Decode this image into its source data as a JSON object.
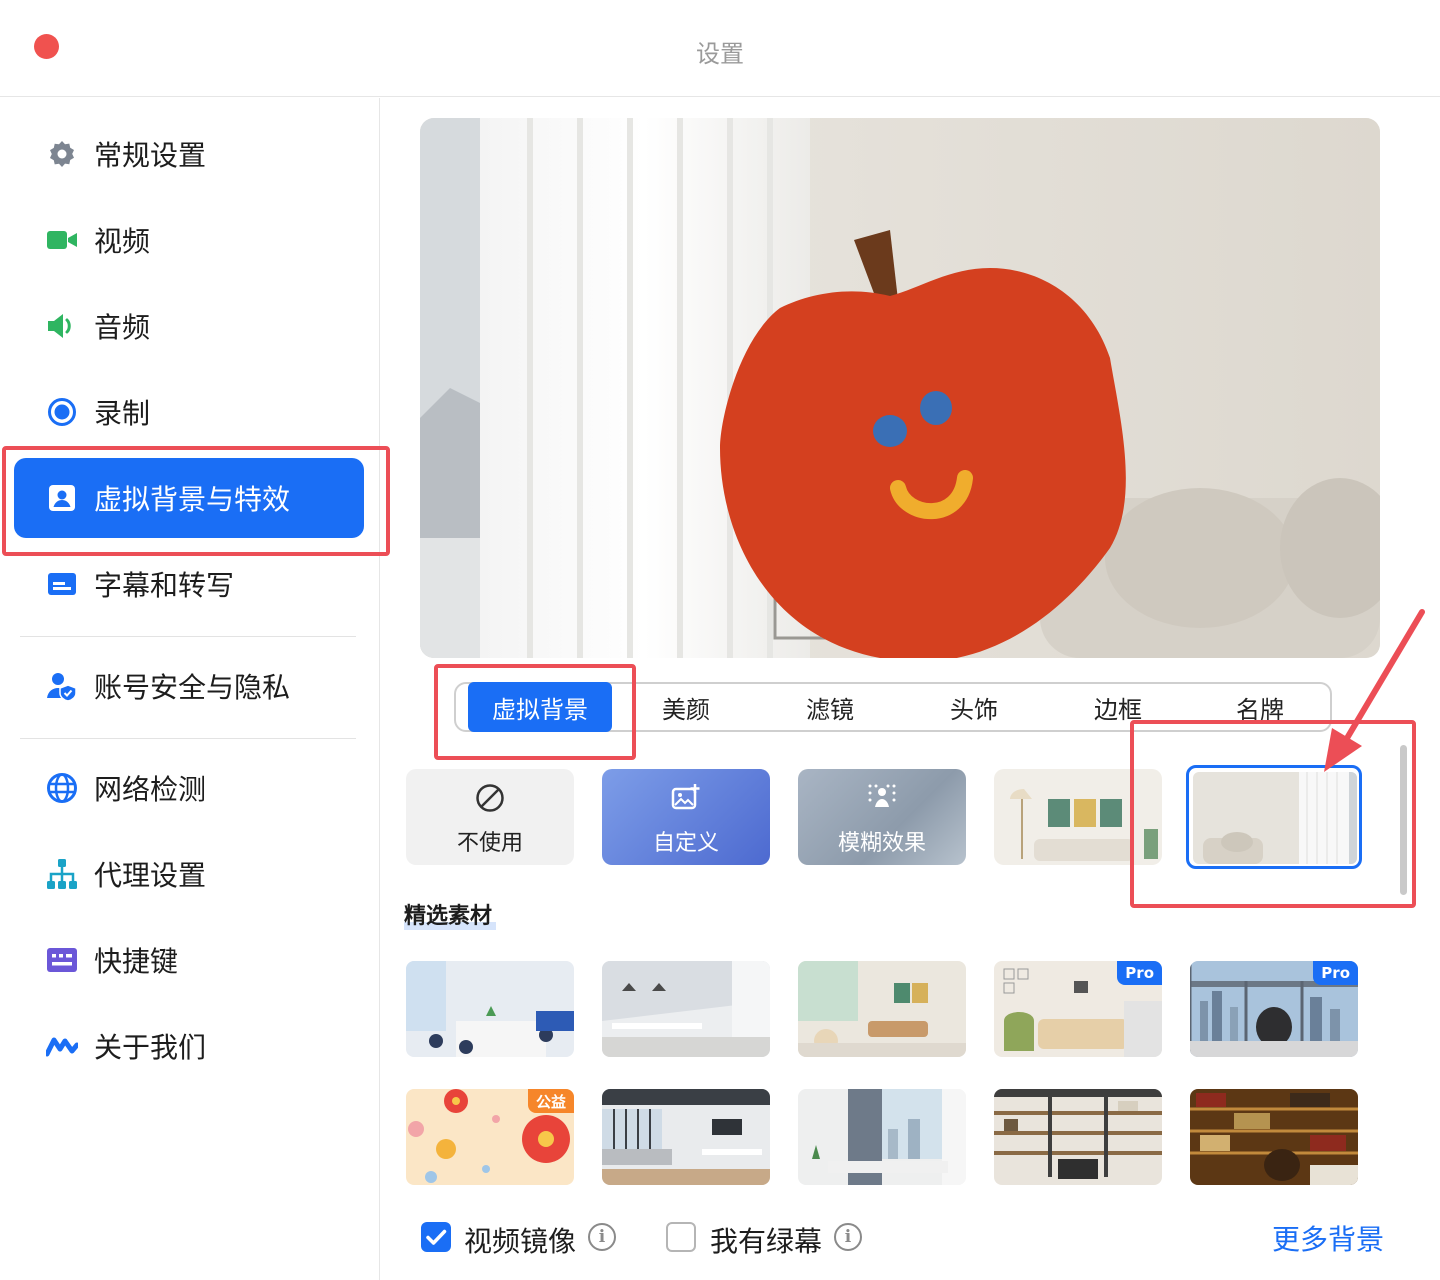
{
  "window": {
    "title": "设置"
  },
  "sidebar": {
    "items": [
      {
        "label": "常规设置",
        "icon": "gear-icon"
      },
      {
        "label": "视频",
        "icon": "video-camera-icon"
      },
      {
        "label": "音频",
        "icon": "speaker-icon"
      },
      {
        "label": "录制",
        "icon": "record-icon"
      },
      {
        "label": "虚拟背景与特效",
        "icon": "portrait-icon",
        "active": true
      },
      {
        "label": "字幕和转写",
        "icon": "subtitles-icon"
      },
      {
        "label": "账号安全与隐私",
        "icon": "user-shield-icon"
      },
      {
        "label": "网络检测",
        "icon": "globe-icon"
      },
      {
        "label": "代理设置",
        "icon": "network-tree-icon"
      },
      {
        "label": "快捷键",
        "icon": "keyboard-icon"
      },
      {
        "label": "关于我们",
        "icon": "tencent-meeting-logo-icon"
      }
    ]
  },
  "tabs": [
    {
      "label": "虚拟背景",
      "active": true
    },
    {
      "label": "美颜"
    },
    {
      "label": "滤镜"
    },
    {
      "label": "头饰"
    },
    {
      "label": "边框"
    },
    {
      "label": "名牌"
    }
  ],
  "backgrounds": {
    "none_label": "不使用",
    "custom_label": "自定义",
    "blur_label": "模糊效果"
  },
  "featured": {
    "title": "精选素材",
    "badges": {
      "pro": "Pro",
      "gongyi": "公益"
    }
  },
  "footer": {
    "mirror_label": "视频镜像",
    "mirror_checked": true,
    "greenscreen_label": "我有绿幕",
    "greenscreen_checked": false,
    "more_label": "更多背景"
  },
  "colors": {
    "accent": "#1a6ef5",
    "highlight_box": "#ec4e56",
    "close_button": "#f0524f"
  }
}
